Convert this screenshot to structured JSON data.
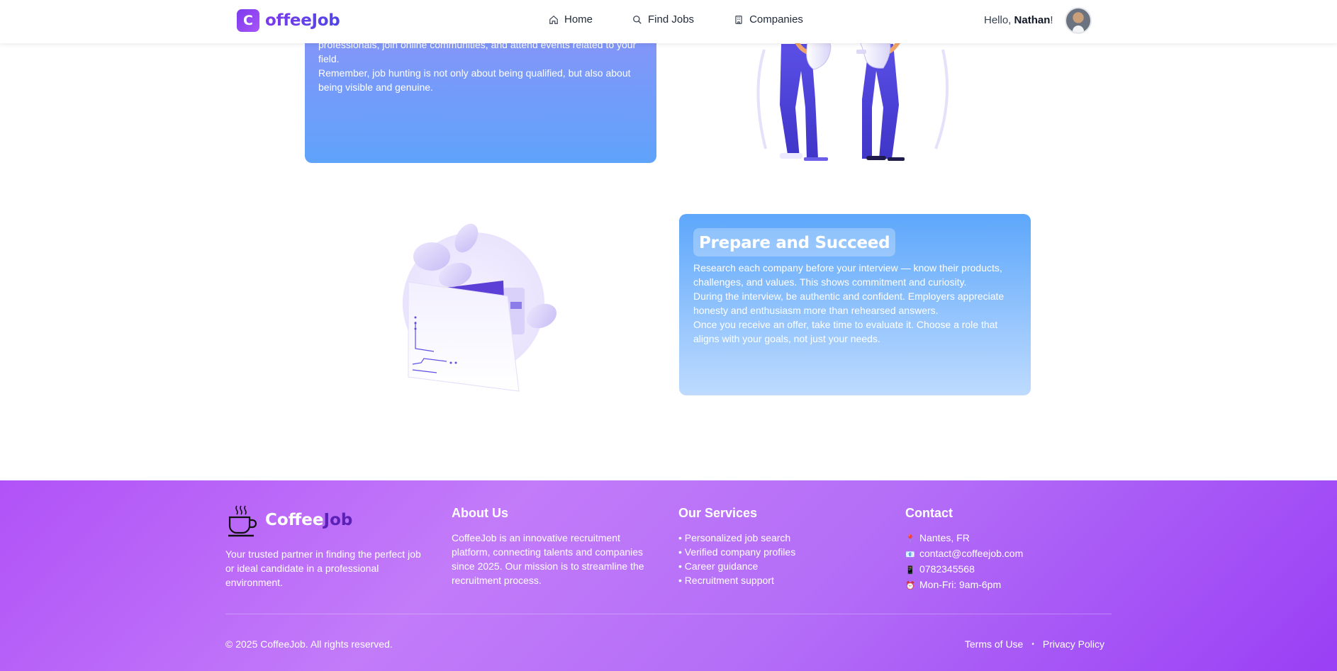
{
  "header": {
    "logo_letter": "C",
    "logo_text": "offeeJob",
    "nav": [
      {
        "label": "Home",
        "icon": "home-icon"
      },
      {
        "label": "Find Jobs",
        "icon": "search-icon"
      },
      {
        "label": "Companies",
        "icon": "building-icon"
      }
    ],
    "greeting": "Hello, ",
    "user_name": "Nathan",
    "greeting_suffix": "!"
  },
  "card_top": {
    "lines": [
      "professionals, join online communities, and attend events related to your field.",
      "Remember, job hunting is not only about being qualified, but also about being visible and genuine."
    ]
  },
  "card_prepare": {
    "title": "Prepare and Succeed",
    "paragraphs": [
      "Research each company before your interview — know their products, challenges, and values. This shows commitment and curiosity.",
      "During the interview, be authentic and confident. Employers appreciate honesty and enthusiasm more than rehearsed answers.",
      "Once you receive an offer, take time to evaluate it. Choose a role that aligns with your goals, not just your needs."
    ]
  },
  "footer": {
    "brand_coffee": "Coffee",
    "brand_job": "Job",
    "brand_desc": "Your trusted partner in finding the perfect job or ideal candidate in a professional environment.",
    "about_heading": "About Us",
    "about_text": "CoffeeJob is an innovative recruitment platform, connecting talents and companies since 2025. Our mission is to streamline the recruitment process.",
    "services_heading": "Our Services",
    "services": [
      "• Personalized job search",
      "• Verified company profiles",
      "• Career guidance",
      "• Recruitment support"
    ],
    "contact_heading": "Contact",
    "contact": [
      {
        "icon": "pin-icon",
        "glyph": "📍",
        "text": "Nantes, FR"
      },
      {
        "icon": "email-icon",
        "glyph": "📧",
        "text": "contact@coffeejob.com"
      },
      {
        "icon": "phone-icon",
        "glyph": "📱",
        "text": "0782345568"
      },
      {
        "icon": "clock-icon",
        "glyph": "⏰",
        "text": "Mon-Fri: 9am-6pm"
      }
    ],
    "copyright": "© 2025 CoffeeJob. All rights reserved.",
    "terms": "Terms of Use",
    "separator": "•",
    "privacy": "Privacy Policy"
  }
}
